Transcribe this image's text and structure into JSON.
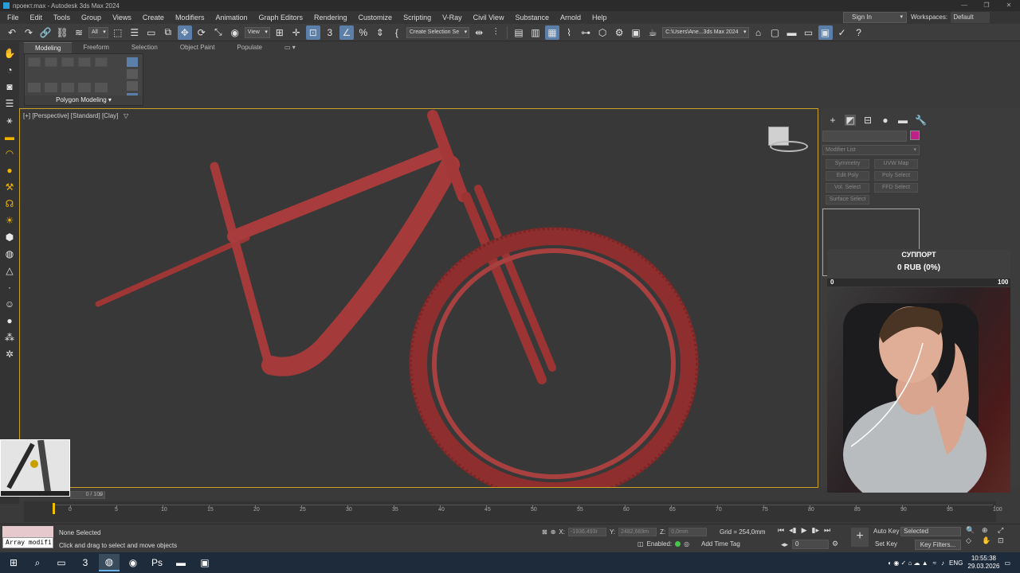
{
  "titlebar": {
    "title": "проект.max - Autodesk 3ds Max 2024",
    "controls": [
      "—",
      "❐",
      "✕"
    ]
  },
  "menu": [
    "File",
    "Edit",
    "Tools",
    "Group",
    "Views",
    "Create",
    "Modifiers",
    "Animation",
    "Graph Editors",
    "Rendering",
    "Customize",
    "Scripting",
    "V-Ray",
    "Civil View",
    "Substance",
    "Arnold",
    "Help"
  ],
  "signin": "Sign In",
  "workspaces": {
    "label": "Workspaces:",
    "value": "Default"
  },
  "toolbar": {
    "filter": "All",
    "refcoord": "View",
    "selection_set": "Create Selection Se",
    "path": "C:\\Users\\Ane...3ds Max 2024"
  },
  "ribbon": {
    "tabs": [
      "Modeling",
      "Freeform",
      "Selection",
      "Object Paint",
      "Populate"
    ],
    "active": "Modeling",
    "footer": "Polygon Modeling"
  },
  "viewport": {
    "label": "[+] [Perspective] [Standard] [Clay]"
  },
  "command_panel": {
    "modifier_list": "Modifier List",
    "buttons": [
      "Symmetry",
      "UVW Map",
      "Edit Poly",
      "Poly Select",
      "Vol. Select",
      "FFD Select",
      "Surface Select"
    ],
    "object_color": "#c0208a"
  },
  "support": {
    "title": "СУППОРТ",
    "amount": "0 RUB (0%)",
    "min": "0",
    "max": "100",
    "progress": 0
  },
  "timeslider": {
    "value": "0 / 100"
  },
  "timeline": {
    "ticks": [
      "0",
      "5",
      "10",
      "15",
      "20",
      "25",
      "30",
      "35",
      "40",
      "45",
      "50",
      "55",
      "60",
      "65",
      "70",
      "75",
      "80",
      "85",
      "90",
      "95",
      "100"
    ]
  },
  "status": {
    "arraybox": "Array modifi",
    "selection": "None Selected",
    "prompt": "Click and drag to select and move objects",
    "x_label": "X:",
    "x": "-1936,493r",
    "y_label": "Y:",
    "y": "2482,669m",
    "z_label": "Z:",
    "z": "0,0mm",
    "grid": "Grid = 254,0mm",
    "enabled": "Enabled:",
    "add_time_tag": "Add Time Tag",
    "frame": "0",
    "auto_key": "Auto Key",
    "set_key": "Set Key",
    "selected": "Selected",
    "key_filters": "Key Filters..."
  },
  "taskbar": {
    "apps": [
      "start-icon",
      "search-icon",
      "taskview-icon",
      "3dsmax-icon",
      "chrome-icon",
      "obs-icon",
      "photoshop-icon",
      "explorer-icon",
      "image-viewer-icon"
    ],
    "lang": "ENG",
    "time": "10:55:38",
    "date": "29.03.2026"
  }
}
